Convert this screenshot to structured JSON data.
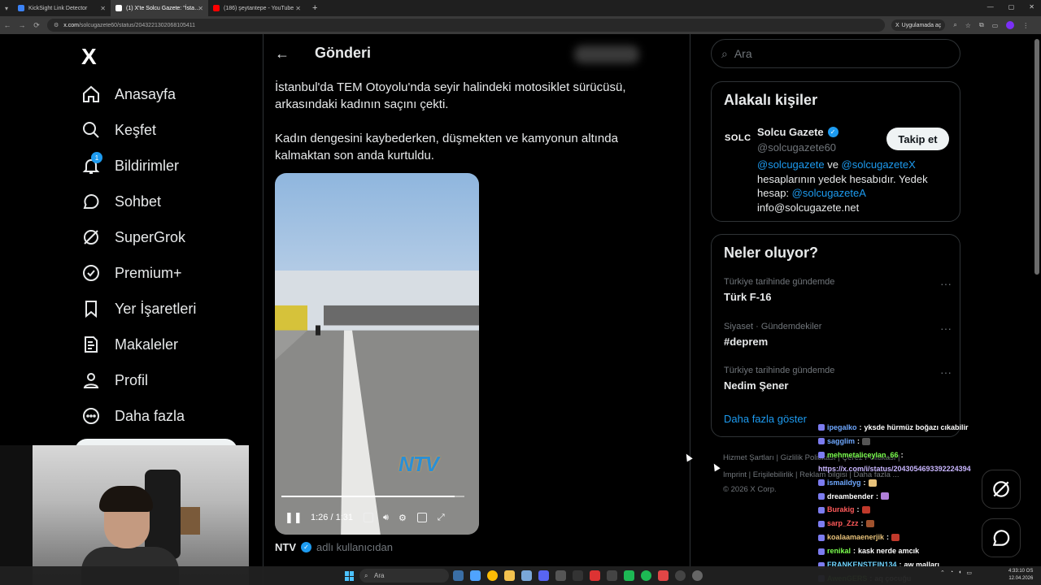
{
  "browser": {
    "tabs": [
      {
        "label": "KickSight Link Detector",
        "fav": "#3b82f6"
      },
      {
        "label": "(1) X'te Solcu Gazete: \"İsta…",
        "fav": "#ffffff"
      },
      {
        "label": "(186) şeytantepe - YouTube",
        "fav": "#ff0000"
      }
    ],
    "new_tab": "+",
    "url_host": "x.com",
    "url_path": "/solcugazete60/status/2043221302068105411",
    "app_pill": "Uygulamada aç"
  },
  "nav": {
    "logo": "X",
    "items": [
      {
        "label": "Anasayfa",
        "icon": "home-icon"
      },
      {
        "label": "Keşfet",
        "icon": "search-icon"
      },
      {
        "label": "Bildirimler",
        "icon": "bell-icon",
        "badge": "1"
      },
      {
        "label": "Sohbet",
        "icon": "chat-icon"
      },
      {
        "label": "SuperGrok",
        "icon": "grok-icon"
      },
      {
        "label": "Premium+",
        "icon": "verified-icon"
      },
      {
        "label": "Yer İşaretleri",
        "icon": "bookmark-icon"
      },
      {
        "label": "Makaleler",
        "icon": "article-icon"
      },
      {
        "label": "Profil",
        "icon": "profile-icon"
      },
      {
        "label": "Daha fazla",
        "icon": "more-icon"
      }
    ]
  },
  "post": {
    "header_title": "Gönderi",
    "text1": "İstanbul'da TEM Otoyolu'nda seyir halindeki motosiklet sürücüsü, arkasındaki kadının saçını çekti.",
    "text2": "Kadın dengesini kaybederken, düşmekten ve kamyonun altında kalmaktan son anda kurtuldu.",
    "video_time": "1:26 / 1:31",
    "video_progress": 0.945,
    "watermark": "NTV",
    "author_name": "NTV",
    "author_sub": "adlı kullanıcıdan"
  },
  "right": {
    "search_placeholder": "Ara",
    "related_title": "Alakalı kişiler",
    "person": {
      "logo": "SOLC",
      "name": "Solcu Gazete",
      "handle": "@solcugazete60",
      "follow": "Takip et",
      "bio_link1": "@solcugazete",
      "bio_and": " ve ",
      "bio_link2": "@solcugazeteX",
      "bio_mid": " hesaplarının yedek hesabıdır. Yedek hesap: ",
      "bio_link3": "@solcugazeteA",
      "bio_email": "info@solcugazete.net"
    },
    "trends_title": "Neler oluyor?",
    "trends": [
      {
        "meta": "Türkiye tarihinde gündemde",
        "title": "Türk F-16"
      },
      {
        "meta": "Siyaset · Gündemdekiler",
        "title": "#deprem"
      },
      {
        "meta": "Türkiye tarihinde gündemde",
        "title": "Nedim Şener"
      }
    ],
    "show_more": "Daha fazla göster",
    "footer_line1": "Hizmet Şartları  |  Gizlilik Politikası  |  Çerez Politikası  |",
    "footer_line2": "Imprint  |  Erişilebilirlik  |  Reklam bilgisi  |  Daha fazla ...",
    "copyright": "© 2026 X Corp."
  },
  "chat": [
    {
      "user": "ipegalko",
      "color": "#6fa8ff",
      "text": "yksde hürmüz boğazı cıkabilir"
    },
    {
      "user": "sagglim",
      "color": "#6fa8ff",
      "text": "",
      "emote": "#555555"
    },
    {
      "user": "mehmetaliceylan_66",
      "color": "#7cff4f",
      "text": ""
    },
    {
      "user": "",
      "color": "#c9b6ff",
      "text": "",
      "link": "https://x.com/i/status/2043054693392224394"
    },
    {
      "user": "ismaildyg",
      "color": "#6fa8ff",
      "text": "",
      "emote": "#e8c27a"
    },
    {
      "user": "dreambender",
      "color": "#ffffff",
      "text": "",
      "emote": "#b07fd9"
    },
    {
      "user": "Burakig",
      "color": "#ff5a5a",
      "text": "",
      "emote": "#c0392b"
    },
    {
      "user": "sarp_Zzz",
      "color": "#ff5a5a",
      "text": "",
      "emote": "#a0522d"
    },
    {
      "user": "koalaamaenerjik",
      "color": "#e8c27a",
      "text": "",
      "emote": "#c0392b"
    },
    {
      "user": "renikal",
      "color": "#7cff4f",
      "text": "kask nerde amcık"
    },
    {
      "user": "FRANKENSTEIN134",
      "color": "#6fd4ff",
      "text": "aw malları"
    },
    {
      "user": "AwenGERS",
      "color": "#7cff4f",
      "text": "aq çocuğu"
    }
  ],
  "taskbar": {
    "search": "Ara",
    "time": "4:33:10 OS",
    "date": "12.04.2026"
  }
}
